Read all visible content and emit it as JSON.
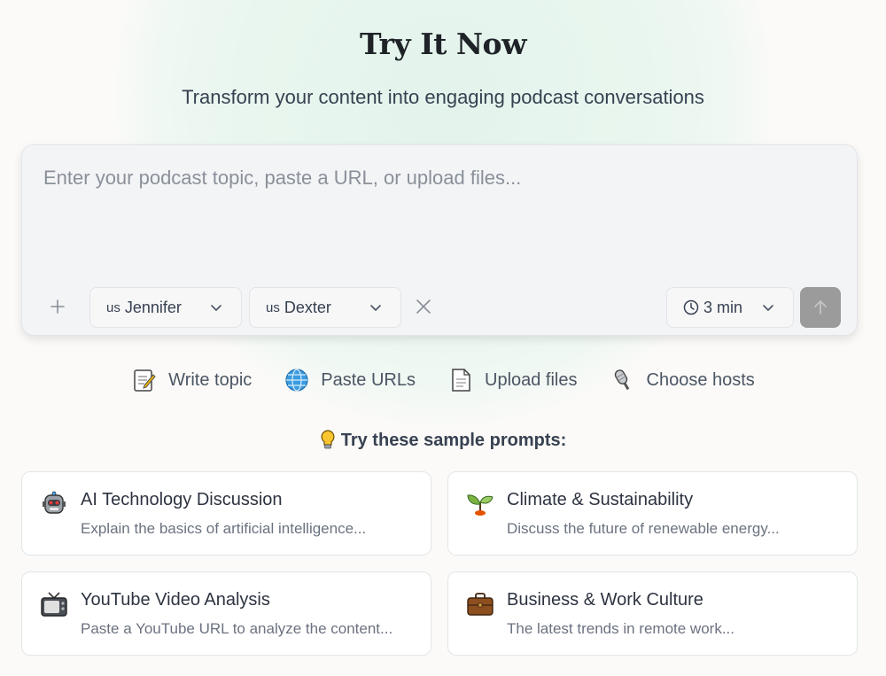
{
  "header": {
    "title": "Try It Now",
    "subtitle": "Transform your content into engaging podcast conversations"
  },
  "composer": {
    "placeholder": "Enter your podcast topic, paste a URL, or upload files...",
    "value": "",
    "hosts": [
      {
        "flag": "us",
        "name": "Jennifer"
      },
      {
        "flag": "us",
        "name": "Dexter"
      }
    ],
    "duration": "3 min"
  },
  "actions": [
    {
      "label": "Write topic",
      "icon": "memo-icon"
    },
    {
      "label": "Paste URLs",
      "icon": "globe-icon"
    },
    {
      "label": "Upload files",
      "icon": "document-icon"
    },
    {
      "label": "Choose hosts",
      "icon": "microphone-icon"
    }
  ],
  "prompts": {
    "heading": "Try these sample prompts:",
    "cards": [
      {
        "title": "AI Technology Discussion",
        "description": "Explain the basics of artificial intelligence...",
        "icon": "robot-icon"
      },
      {
        "title": "Climate & Sustainability",
        "description": "Discuss the future of renewable energy...",
        "icon": "seedling-icon"
      },
      {
        "title": "YouTube Video Analysis",
        "description": "Paste a YouTube URL to analyze the content...",
        "icon": "television-icon"
      },
      {
        "title": "Business & Work Culture",
        "description": "The latest trends in remote work...",
        "icon": "briefcase-icon"
      }
    ]
  },
  "colors": {
    "background": "#fbfaf8",
    "glow": "#e3f4ec",
    "send_button_disabled": "#9b9b9b",
    "composer_bg": "#f3f4f6"
  }
}
